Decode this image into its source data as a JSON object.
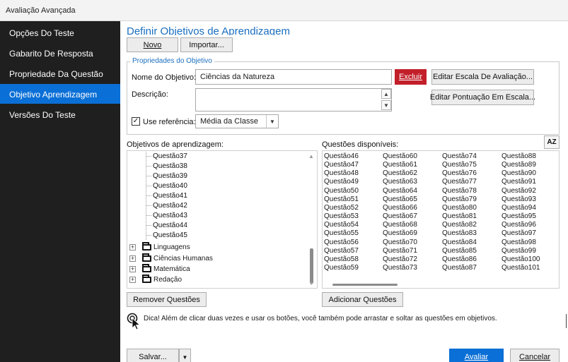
{
  "window": {
    "title": "Avaliação Avançada"
  },
  "sidebar": {
    "items": [
      {
        "label": "Opções Do Teste",
        "active": false
      },
      {
        "label": "Gabarito De Resposta",
        "active": false
      },
      {
        "label": "Propriedade Da Questão",
        "active": false
      },
      {
        "label": "Objetivo Aprendizagem",
        "active": true
      },
      {
        "label": "Versões Do Teste",
        "active": false
      }
    ]
  },
  "main": {
    "heading": "Definir Objetivos de Aprendizagem",
    "toolbar": {
      "new_label": "Novo",
      "import_label": "Importar..."
    },
    "properties": {
      "legend": "Propriedades do Objetivo",
      "name_label": "Nome do Objetivo:",
      "name_value": "Ciências da Natureza",
      "delete_label": "Excluir",
      "edit_scale_label": "Editar Escala De Avaliação...",
      "description_label": "Descrição:",
      "description_value": "",
      "edit_score_label": "Editar Pontuação Em Escala...",
      "use_reference_label": "Use referência:",
      "use_reference_checked": true,
      "reference_value": "Média da Classe"
    },
    "objectives": {
      "label": "Objetivos de aprendizagem:",
      "questions": [
        "Questão37",
        "Questão38",
        "Questão39",
        "Questão40",
        "Questão41",
        "Questão42",
        "Questão43",
        "Questão44",
        "Questão45"
      ],
      "groups": [
        "Linguagens",
        "Ciências Humanas",
        "Matemática",
        "Redação"
      ],
      "remove_label": "Remover Questões"
    },
    "available": {
      "label": "Questões disponíveis:",
      "sort_icon_text": "AZ",
      "columns": [
        [
          "Questão46",
          "Questão47",
          "Questão48",
          "Questão49",
          "Questão50",
          "Questão51",
          "Questão52",
          "Questão53",
          "Questão54",
          "Questão55",
          "Questão56",
          "Questão57",
          "Questão58",
          "Questão59"
        ],
        [
          "Questão60",
          "Questão61",
          "Questão62",
          "Questão63",
          "Questão64",
          "Questão65",
          "Questão66",
          "Questão67",
          "Questão68",
          "Questão69",
          "Questão70",
          "Questão71",
          "Questão72",
          "Questão73"
        ],
        [
          "Questão74",
          "Questão75",
          "Questão76",
          "Questão77",
          "Questão78",
          "Questão79",
          "Questão80",
          "Questão81",
          "Questão82",
          "Questão83",
          "Questão84",
          "Questão85",
          "Questão86",
          "Questão87"
        ],
        [
          "Questão88",
          "Questão89",
          "Questão90",
          "Questão91",
          "Questão92",
          "Questão93",
          "Questão94",
          "Questão95",
          "Questão96",
          "Questão97",
          "Questão98",
          "Questão99",
          "Questão100",
          "Questão101"
        ]
      ],
      "add_label": "Adicionar Questões"
    },
    "tip": "Dica! Além de clicar duas vezes e usar os botões, você também pode arrastar e soltar as questões em objetivos.",
    "footer": {
      "save_label": "Salvar...",
      "evaluate_label": "Avaliar",
      "cancel_label": "Cancelar"
    }
  },
  "colors": {
    "accent": "#0a6fd6",
    "danger": "#c21f2a",
    "sidebar_bg": "#1f1f1f",
    "heading": "#1a6ec0"
  }
}
